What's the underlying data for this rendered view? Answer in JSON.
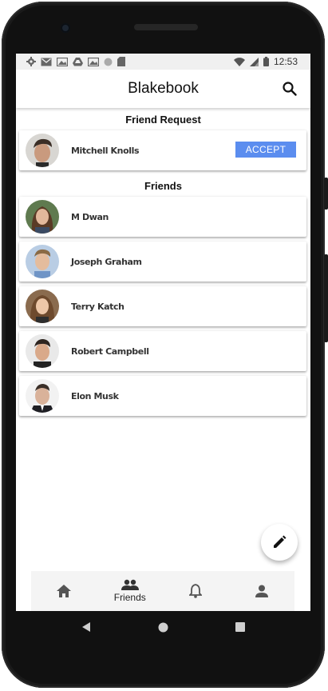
{
  "status_bar": {
    "time": "12:53",
    "left_icons": [
      "gear-icon",
      "gmail-icon",
      "gallery-icon",
      "drive-icon",
      "gallery-icon-2",
      "circle-icon",
      "sd-card-icon"
    ],
    "right_icons": [
      "wifi-icon",
      "signal-icon",
      "battery-icon"
    ]
  },
  "app_bar": {
    "title": "Blakebook",
    "search_icon": "search-icon"
  },
  "friend_request": {
    "title": "Friend Request",
    "items": [
      {
        "name": "Mitchell Knolls",
        "accept_label": "ACCEPT"
      }
    ]
  },
  "friends": {
    "title": "Friends",
    "items": [
      {
        "name": "M Dwan"
      },
      {
        "name": "Joseph Graham"
      },
      {
        "name": "Terry Katch"
      },
      {
        "name": "Robert Campbell"
      },
      {
        "name": "Elon Musk"
      }
    ]
  },
  "fab": {
    "icon": "edit-icon"
  },
  "bottom_nav": {
    "items": [
      {
        "icon": "home-icon",
        "label": ""
      },
      {
        "icon": "friends-icon",
        "label": "Friends"
      },
      {
        "icon": "bell-icon",
        "label": ""
      },
      {
        "icon": "person-icon",
        "label": ""
      }
    ]
  },
  "colors": {
    "accent": "#5b8def",
    "status_bar_bg": "#f0f0f0",
    "bottom_nav_bg": "#f4f4f4"
  }
}
